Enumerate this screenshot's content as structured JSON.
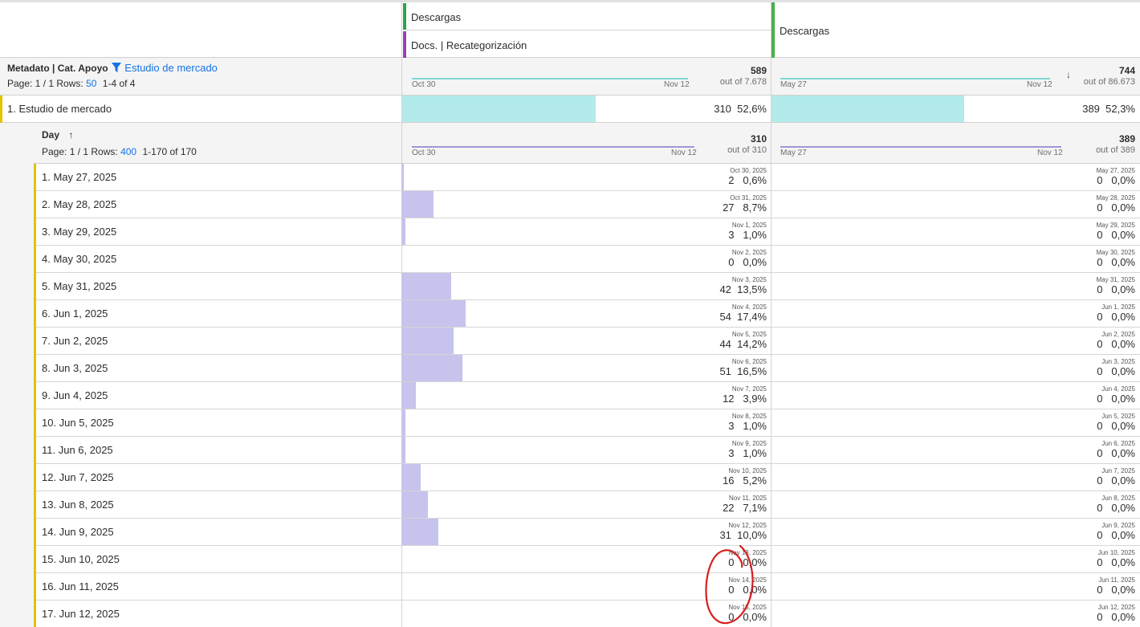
{
  "colors": {
    "metric1_accent": "#2da44e",
    "segment_accent": "#9b3fb5",
    "metric2_accent": "#4caf50",
    "top_bar": "#b2ebe9",
    "row_bar": "#c6c3ec",
    "row_accent": "#e5c100",
    "sparkline_top": "#7fd6d4",
    "sparkline_day": "#9b97d6",
    "link_blue": "#1473e6",
    "annotation_red": "#d61f1f"
  },
  "header": {
    "col1_metric": "Descargas",
    "col1_segment": "Docs. | Recategorización",
    "col2_metric": "Descargas"
  },
  "summary": {
    "dimension_title": "Metadato | Cat. Apoyo",
    "filter_label": "Estudio de mercado",
    "page_text": "Page: 1 / 1",
    "rows_label": "Rows:",
    "rows_value": "50",
    "range_text": "1-4 of 4",
    "col1": {
      "total": "589",
      "out_of": "out of 7.678",
      "start": "Oct 30",
      "end": "Nov 12"
    },
    "col2": {
      "total": "744",
      "out_of": "out of 86.673",
      "start": "May 27",
      "end": "Nov 12",
      "sort_icon": "arrow-down-icon"
    }
  },
  "top_row": {
    "label": "1.  Estudio de mercado",
    "col1_value": "310  52,6%",
    "col1_share": 0.526,
    "col2_value": "389  52,3%",
    "col2_share": 0.523
  },
  "day_summary": {
    "title": "Day",
    "sort_icon": "arrow-up-icon",
    "page_text": "Page: 1 / 1",
    "rows_label": "Rows:",
    "rows_value": "400",
    "range_text": "1-170 of 170",
    "col1": {
      "total": "310",
      "out_of": "out of 310",
      "start": "Oct 30",
      "end": "Nov 12"
    },
    "col2": {
      "total": "389",
      "out_of": "out of 389",
      "start": "May 27",
      "end": "Nov 12"
    }
  },
  "rows": [
    {
      "label": "1.  May 27, 2025",
      "d1": "Oct 30, 2025",
      "v1": "2   0,6%",
      "p1": 0.006,
      "d2": "May 27, 2025",
      "v2": "0   0,0%"
    },
    {
      "label": "2.  May 28, 2025",
      "d1": "Oct 31, 2025",
      "v1": "27   8,7%",
      "p1": 0.087,
      "d2": "May 28, 2025",
      "v2": "0   0,0%"
    },
    {
      "label": "3.  May 29, 2025",
      "d1": "Nov 1, 2025",
      "v1": "3   1,0%",
      "p1": 0.01,
      "d2": "May 29, 2025",
      "v2": "0   0,0%"
    },
    {
      "label": "4.  May 30, 2025",
      "d1": "Nov 2, 2025",
      "v1": "0   0,0%",
      "p1": 0.0,
      "d2": "May 30, 2025",
      "v2": "0   0,0%"
    },
    {
      "label": "5.  May 31, 2025",
      "d1": "Nov 3, 2025",
      "v1": "42  13,5%",
      "p1": 0.135,
      "d2": "May 31, 2025",
      "v2": "0   0,0%"
    },
    {
      "label": "6.  Jun 1, 2025",
      "d1": "Nov 4, 2025",
      "v1": "54  17,4%",
      "p1": 0.174,
      "d2": "Jun 1, 2025",
      "v2": "0   0,0%"
    },
    {
      "label": "7.  Jun 2, 2025",
      "d1": "Nov 5, 2025",
      "v1": "44  14,2%",
      "p1": 0.142,
      "d2": "Jun 2, 2025",
      "v2": "0   0,0%"
    },
    {
      "label": "8.  Jun 3, 2025",
      "d1": "Nov 6, 2025",
      "v1": "51  16,5%",
      "p1": 0.165,
      "d2": "Jun 3, 2025",
      "v2": "0   0,0%"
    },
    {
      "label": "9.  Jun 4, 2025",
      "d1": "Nov 7, 2025",
      "v1": "12   3,9%",
      "p1": 0.039,
      "d2": "Jun 4, 2025",
      "v2": "0   0,0%"
    },
    {
      "label": "10.  Jun 5, 2025",
      "d1": "Nov 8, 2025",
      "v1": "3   1,0%",
      "p1": 0.01,
      "d2": "Jun 5, 2025",
      "v2": "0   0,0%"
    },
    {
      "label": "11.  Jun 6, 2025",
      "d1": "Nov 9, 2025",
      "v1": "3   1,0%",
      "p1": 0.01,
      "d2": "Jun 6, 2025",
      "v2": "0   0,0%"
    },
    {
      "label": "12.  Jun 7, 2025",
      "d1": "Nov 10, 2025",
      "v1": "16   5,2%",
      "p1": 0.052,
      "d2": "Jun 7, 2025",
      "v2": "0   0,0%"
    },
    {
      "label": "13.  Jun 8, 2025",
      "d1": "Nov 11, 2025",
      "v1": "22   7,1%",
      "p1": 0.071,
      "d2": "Jun 8, 2025",
      "v2": "0   0,0%"
    },
    {
      "label": "14.  Jun 9, 2025",
      "d1": "Nov 12, 2025",
      "v1": "31  10,0%",
      "p1": 0.1,
      "d2": "Jun 9, 2025",
      "v2": "0   0,0%"
    },
    {
      "label": "15.  Jun 10, 2025",
      "d1": "Nov 13, 2025",
      "v1": "0   0,0%",
      "p1": 0.0,
      "d2": "Jun 10, 2025",
      "v2": "0   0,0%"
    },
    {
      "label": "16.  Jun 11, 2025",
      "d1": "Nov 14, 2025",
      "v1": "0   0,0%",
      "p1": 0.0,
      "d2": "Jun 11, 2025",
      "v2": "0   0,0%"
    },
    {
      "label": "17.  Jun 12, 2025",
      "d1": "Nov 15, 2025",
      "v1": "0   0,0%",
      "p1": 0.0,
      "d2": "Jun 12, 2025",
      "v2": "0   0,0%"
    }
  ]
}
